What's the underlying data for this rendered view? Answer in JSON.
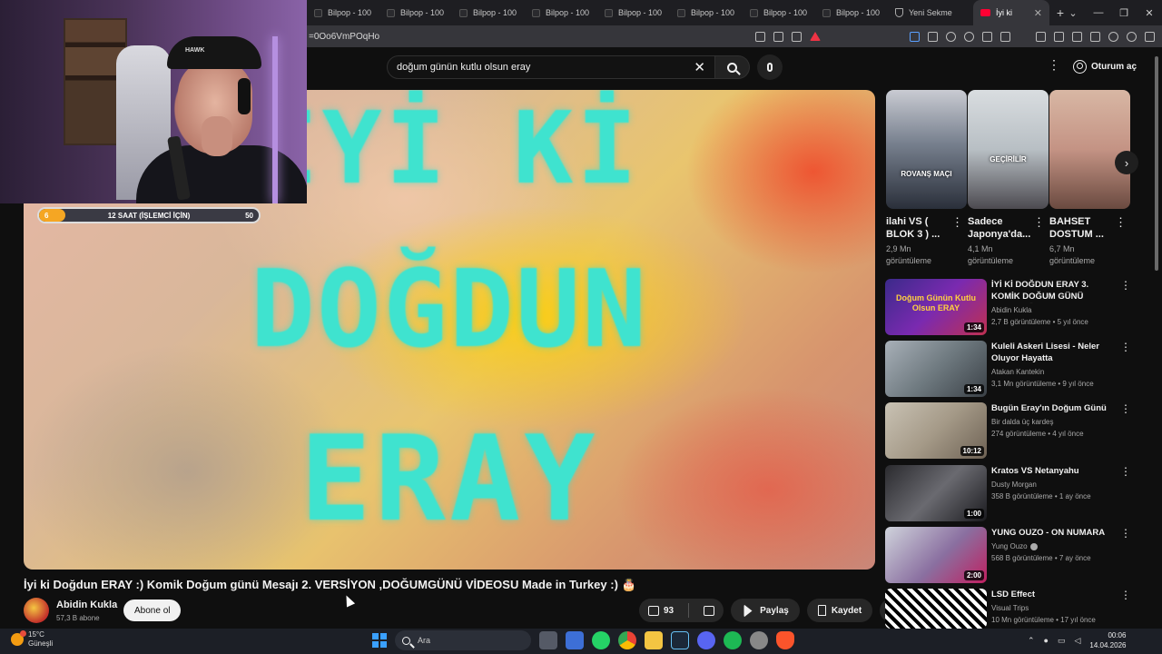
{
  "browser": {
    "tabs": [
      {
        "label": "Bilpop - 100"
      },
      {
        "label": "Bilpop - 100"
      },
      {
        "label": "Bilpop - 100"
      },
      {
        "label": "Bilpop - 100"
      },
      {
        "label": "Bilpop - 100"
      },
      {
        "label": "Bilpop - 100"
      },
      {
        "label": "Bilpop - 100"
      },
      {
        "label": "Bilpop - 100"
      },
      {
        "label": "Yeni Sekme"
      },
      {
        "label": "İyi ki"
      }
    ],
    "url": "=0Oo6VmPOqHo",
    "brand_color": "#ff0033"
  },
  "youtube": {
    "search": {
      "query": "doğum günün kutlu olsun eray"
    },
    "signin_label": "Oturum aç",
    "video": {
      "overlay_text": [
        "İYİ Kİ",
        "DOĞDUN",
        "ERAY"
      ],
      "title": "İyi ki Doğdun ERAY :) Komik Doğum günü Mesajı 2. VERSİYON ,DOĞUMGÜNÜ VİDEOSU Made in Turkey :) 🎂",
      "channel": "Abidin Kukla",
      "subscribers": "57,3 B abone",
      "subscribe_label": "Abone ol",
      "likes": "93",
      "share_label": "Paylaş",
      "save_label": "Kaydet"
    },
    "shorts": [
      {
        "title": "ilahi VS ( BLOK 3 ) ...",
        "views": "2,9 Mn görüntüleme",
        "caption": "ROVANŞ MAÇI"
      },
      {
        "title": "Sadece Japonya'da...",
        "views": "4,1 Mn görüntüleme",
        "caption": "GEÇİRİLİR"
      },
      {
        "title": "BAHSET DOSTUM ...",
        "views": "6,7 Mn görüntüleme",
        "caption": ""
      }
    ],
    "recommendations": [
      {
        "title": "İYİ Kİ DOĞDUN ERAY 3. KOMİK DOĞUM GÜNÜ MESAJI 🎂 ...",
        "channel": "Abidin Kukla",
        "meta": "2,7 B görüntüleme • 5 yıl önce",
        "duration": "1:34",
        "thumb_text": "Doğum Günün Kutlu Olsun ERAY"
      },
      {
        "title": "Kuleli Askeri Lisesi - Neler Oluyor Hayatta",
        "channel": "Atakan Kantekin",
        "meta": "3,1 Mn görüntüleme • 9 yıl önce",
        "duration": "1:34",
        "thumb_text": ""
      },
      {
        "title": "Bugün Eray'ın Doğum Günü",
        "channel": "Bir dalda üç kardeş",
        "meta": "274 görüntüleme • 4 yıl önce",
        "duration": "10:12",
        "thumb_text": ""
      },
      {
        "title": "Kratos VS Netanyahu",
        "channel": "Dusty Morgan",
        "meta": "358 B görüntüleme • 1 ay önce",
        "duration": "1:00",
        "thumb_text": ""
      },
      {
        "title": "YUNG OUZO - ON NUMARA",
        "channel": "Yung Ouzo",
        "meta": "568 B görüntüleme • 7 ay önce",
        "duration": "2:00",
        "thumb_text": ""
      },
      {
        "title": "LSD Effect",
        "channel": "Visual Trips",
        "meta": "10 Mn görüntüleme • 17 yıl önce",
        "duration": "",
        "thumb_text": ""
      }
    ]
  },
  "stream_overlay": {
    "left_value": "6",
    "label": "12 SAAT (İŞLEMCİ İÇİN)",
    "right_value": "50",
    "progress": 0.12,
    "cap_logo": "HAWK"
  },
  "taskbar": {
    "temperature": "15°C",
    "weather": "Güneşli",
    "search_label": "Ara",
    "time": "00:06",
    "date": "14.04.2026"
  }
}
